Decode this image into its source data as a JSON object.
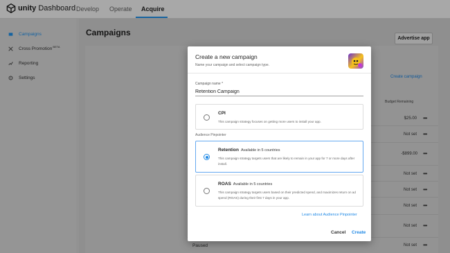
{
  "header": {
    "logo_brand": "unity",
    "logo_product": "Dashboard",
    "nav": [
      "Develop",
      "Operate",
      "Acquire"
    ],
    "active_nav": "Acquire"
  },
  "sidebar": {
    "items": [
      {
        "label": "Campaigns",
        "icon": "campaigns-icon",
        "active": true
      },
      {
        "label": "Cross Promotion",
        "badge": "BETA",
        "icon": "cross-promotion-icon"
      },
      {
        "label": "Reporting",
        "icon": "reporting-icon"
      },
      {
        "label": "Settings",
        "icon": "settings-icon"
      }
    ]
  },
  "main": {
    "title": "Campaigns",
    "advertise_button": "Advertise app",
    "create_campaign_link": "Create campaign",
    "column_header": "Budget Remaining",
    "rows": [
      {
        "value": "$25.00"
      },
      {
        "value": "Not set"
      },
      {
        "value": "Not set"
      },
      {
        "value": "-$899.00"
      },
      {
        "value": "Not set"
      },
      {
        "value": "Not set"
      },
      {
        "value": "Not set"
      },
      {
        "value": "Not set"
      },
      {
        "value": "Not set"
      }
    ],
    "paused_label": "Paused"
  },
  "dialog": {
    "title": "Create a new campaign",
    "subtitle": "Name your campaign and select campaign type.",
    "name_label": "Campaign name *",
    "name_value": "Retention Campaign",
    "section_label": "Audience Pinpointer",
    "options": [
      {
        "title": "CPI",
        "badge": "",
        "description": "This campaign strategy focuses on getting more users to install your app.",
        "selected": false
      },
      {
        "title": "Retention",
        "badge": "Available in 5 countries",
        "description": "This campaign strategy targets users that are likely to remain in your app for 7 or more days after install.",
        "selected": true
      },
      {
        "title": "ROAS",
        "badge": "Available in 5 countries",
        "description": "This campaign strategy targets users based on their predicted spend, and maximizes return on ad spend (ROAS) during their first 7 days in your app.",
        "selected": false
      }
    ],
    "learn_link": "Learn about Audience Pinpointer",
    "cancel_label": "Cancel",
    "create_label": "Create"
  },
  "colors": {
    "accent": "#1e88e5",
    "overlay": "rgba(0,0,0,0.34)"
  }
}
